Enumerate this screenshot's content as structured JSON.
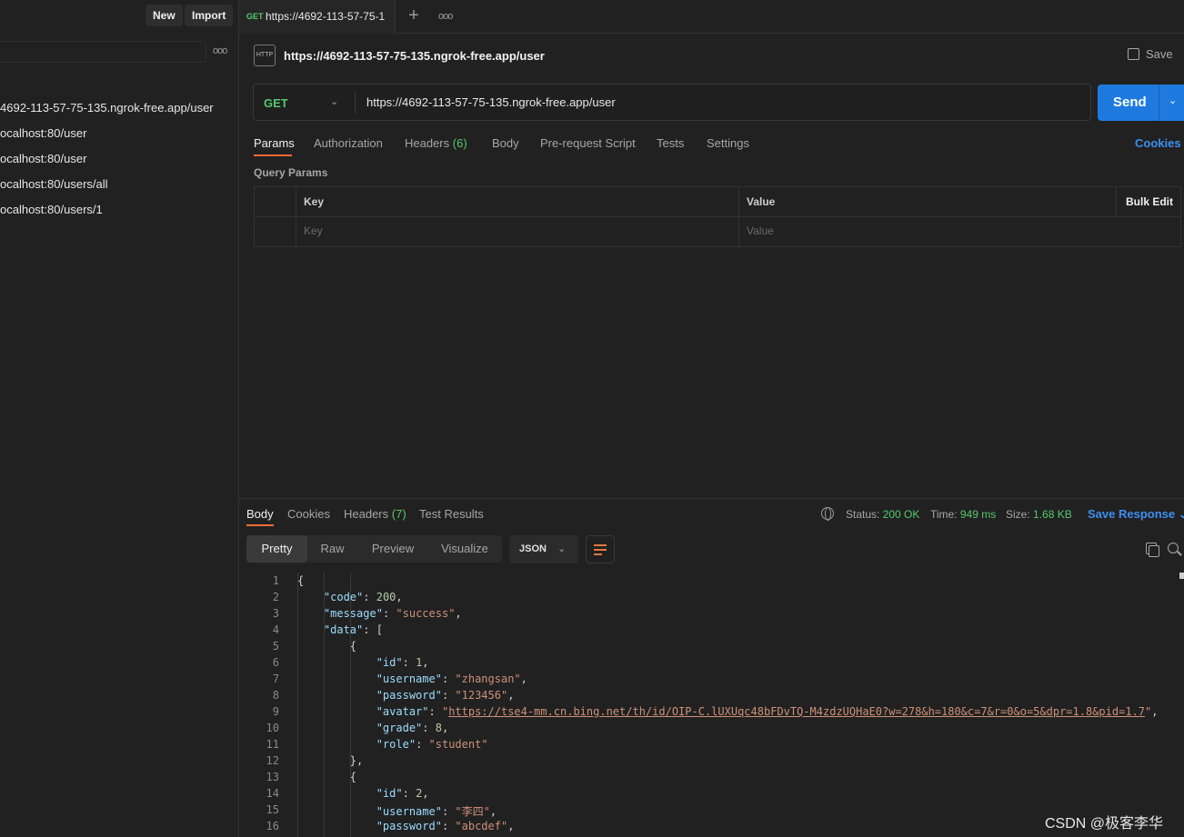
{
  "sidebar": {
    "new_label": "New",
    "import_label": "Import",
    "more_icon": "more-horizontal-icon",
    "history": [
      "4692-113-57-75-135.ngrok-free.app/user",
      "ocalhost:80/user",
      "ocalhost:80/user",
      "ocalhost:80/users/all",
      "ocalhost:80/users/1"
    ]
  },
  "tabbar": {
    "tab": {
      "method": "GET",
      "title": "https://4692-113-57-75-1"
    },
    "plus": "+",
    "more": "ooo"
  },
  "request": {
    "icon_text": "HTTP",
    "title": "https://4692-113-57-75-135.ngrok-free.app/user",
    "save_label": "Save",
    "method": "GET",
    "url": "https://4692-113-57-75-135.ngrok-free.app/user",
    "send_label": "Send",
    "tabs": {
      "params": "Params",
      "authorization": "Authorization",
      "headers": "Headers",
      "headers_count": "(6)",
      "body": "Body",
      "prerequest": "Pre-request Script",
      "tests": "Tests",
      "settings": "Settings"
    },
    "cookies_link": "Cookies",
    "query_params_label": "Query Params",
    "table": {
      "key_header": "Key",
      "value_header": "Value",
      "bulk_edit": "Bulk Edit",
      "key_placeholder": "Key",
      "value_placeholder": "Value"
    }
  },
  "response": {
    "tabs": {
      "body": "Body",
      "cookies": "Cookies",
      "headers": "Headers",
      "headers_count": "(7)",
      "test_results": "Test Results"
    },
    "status_label": "Status:",
    "status_value": "200 OK",
    "time_label": "Time:",
    "time_value": "949 ms",
    "size_label": "Size:",
    "size_value": "1.68 KB",
    "save_response": "Save Response",
    "formats": {
      "pretty": "Pretty",
      "raw": "Raw",
      "preview": "Preview",
      "visualize": "Visualize"
    },
    "language": "JSON",
    "lines": [
      {
        "n": "1",
        "code": "{"
      },
      {
        "n": "2",
        "code": "    \"code\": 200,"
      },
      {
        "n": "3",
        "code": "    \"message\": \"success\","
      },
      {
        "n": "4",
        "code": "    \"data\": ["
      },
      {
        "n": "5",
        "code": "        {"
      },
      {
        "n": "6",
        "code": "            \"id\": 1,"
      },
      {
        "n": "7",
        "code": "            \"username\": \"zhangsan\","
      },
      {
        "n": "8",
        "code": "            \"password\": \"123456\","
      },
      {
        "n": "9",
        "code": "            \"avatar\": \"https://tse4-mm.cn.bing.net/th/id/OIP-C.lUXUqc48bFDvTQ-M4zdzUQHaE0?w=278&h=180&c=7&r=0&o=5&dpr=1.8&pid=1.7\","
      },
      {
        "n": "10",
        "code": "            \"grade\": 8,"
      },
      {
        "n": "11",
        "code": "            \"role\": \"student\""
      },
      {
        "n": "12",
        "code": "        },"
      },
      {
        "n": "13",
        "code": "        {"
      },
      {
        "n": "14",
        "code": "            \"id\": 2,"
      },
      {
        "n": "15",
        "code": "            \"username\": \"李四\","
      },
      {
        "n": "16",
        "code": "            \"password\": \"abcdef\","
      }
    ]
  },
  "watermark": "CSDN @极客李华"
}
